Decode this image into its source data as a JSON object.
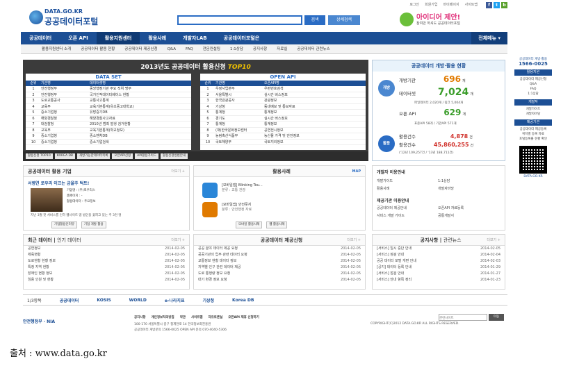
{
  "toplinks": [
    "로그인",
    "회원가입",
    "마이페이지",
    "사이트맵"
  ],
  "social": [
    {
      "label": "f",
      "color": "#3b5998"
    },
    {
      "label": "t",
      "color": "#1da1f2"
    },
    {
      "label": "b",
      "color": "#5aa02c"
    }
  ],
  "logo": {
    "en": "DATA.GO.KR",
    "ko": "공공데이터포털"
  },
  "search": {
    "placeholder": "",
    "button": "검색",
    "advanced": "상세검색"
  },
  "idea": {
    "title": "아이디어 제안!",
    "subtitle": "참여만 하셔도 공공데이터포털"
  },
  "nav": {
    "items": [
      "공공데이터",
      "오픈 API",
      "활용지원센터",
      "활용사례",
      "개발자LAB",
      "공공데이터포털은"
    ],
    "all": "전체메뉴 ▾"
  },
  "subnav": [
    "활용지원센터 소개",
    "공공데이터 활용 현황",
    "공공데이터 제공신청",
    "Q&A",
    "FAQ",
    "전문컨설팅",
    "1:1상담",
    "공지사항",
    "자료실",
    "공공데이터 관련뉴스"
  ],
  "banner": {
    "title_pre": "2013년도 공공데이터 활용신청 ",
    "title_em": "TOP10",
    "dataset": {
      "head": "DATA SET",
      "cols": [
        "순위",
        "기관명",
        "데이터셋명"
      ],
      "rows": [
        [
          "1",
          "안전행정부",
          "중앙행정기관 주요 직위 명부"
        ],
        [
          "2",
          "안전행정부",
          "국가인적데이터베이스 현황"
        ],
        [
          "3",
          "도로교통공사",
          "교통사고통계"
        ],
        [
          "4",
          "교육부",
          "교육기본통계(유초중고대학교)"
        ],
        [
          "5",
          "중소기업청",
          "유망중기DB"
        ],
        [
          "6",
          "해양경찰청",
          "해양경찰사고자료"
        ],
        [
          "7",
          "대검찰청",
          "2010년 범죄 발생 검거현황"
        ],
        [
          "8",
          "교육부",
          "교육기본통계(학교정보)"
        ],
        [
          "9",
          "중소기업청",
          "중소벤처DB"
        ],
        [
          "10",
          "중소기업청",
          "중소기업검색"
        ]
      ]
    },
    "openapi": {
      "head": "OPEN API",
      "cols": [
        "순위",
        "기관명",
        "오픈API명"
      ],
      "rows": [
        [
          "1",
          "우정사업본부",
          "우편번호검색"
        ],
        [
          "2",
          "서울특별시",
          "실시간 버스정보"
        ],
        [
          "3",
          "한국관광공사",
          "관광정보"
        ],
        [
          "4",
          "기상청",
          "동네예보 및 통보자료"
        ],
        [
          "5",
          "통계청",
          "통계정보"
        ],
        [
          "6",
          "경기도",
          "실시간 버스정보"
        ],
        [
          "7",
          "통계청",
          "통계정보"
        ],
        [
          "8",
          "(재)한국문화정보센터",
          "공연전시정보"
        ],
        [
          "9",
          "농림축산식품부",
          "농산물 가격 및 안전정보"
        ],
        [
          "10",
          "국토해양부",
          "국토지리정보"
        ]
      ]
    },
    "bar": [
      "활용신청 TOP10",
      "KOREA DB",
      "개방가능한데이터목록",
      "오픈API신청",
      "API활용가이드",
      "활용신청방법안내"
    ]
  },
  "stats": {
    "title": "공공데이터 개방·활용 현황",
    "open_badge": "개방",
    "use_badge": "활용",
    "rows": [
      {
        "label": "개방기관",
        "value": "696",
        "unit": "개"
      },
      {
        "label": "데이터셋",
        "value": "7,024",
        "unit": "개"
      },
      {
        "label": "오픈 API",
        "value": "629",
        "unit": "개"
      }
    ],
    "note1": "파일데이터 2,020개 / 링크 5,004개",
    "note2": "표준API 58개 / 기관API 571개",
    "use_rows": [
      {
        "label": "활용건수",
        "value": "4,878",
        "unit": "건"
      },
      {
        "label": "활용건수",
        "value": "45,860,255",
        "unit": "건"
      }
    ],
    "note3": "('12년 109,257건 / '13년 188,711건)"
  },
  "company": {
    "title": "공공데이터 활용 기업",
    "more": "더보기 +",
    "headline": "서병연 로우리 이끄는 금을주 턱트!",
    "lines": [
      "기업명 : (주)로우리스",
      "홈페이지 : -",
      "활용데이터 : 주요정보"
    ],
    "desc": "지난 3월 첫 서비스를 인하 웹사이트 앱 법인을 꽃피고 있는 주 3천 명 ",
    "buttons": [
      "기업활용인터뷰",
      "기업 개발 활용"
    ]
  },
  "cases": {
    "title": "활용사례",
    "badge": "MAP",
    "items": [
      {
        "title": "[모바일앱] Blinking Tou...",
        "sub": "분류 : 교통 관광"
      },
      {
        "title": "[모바일앱] 안전뭇지",
        "sub": "분류 : 안전행정 자료"
      }
    ],
    "buttons": [
      "모바일 활용사례",
      "웹 활용사례"
    ]
  },
  "devinfo": {
    "title": "개발자 이용안내",
    "items": [
      "개발가이드",
      "1:1상담",
      "활용사례",
      "개발자마당"
    ],
    "title2": "제공기관 이용안내",
    "items2": [
      "공공데이터 제공안내",
      "오픈API 자료등록",
      "서비스 개발 가이드",
      "공통개발서"
    ]
  },
  "latest": {
    "title": "최근 데이터",
    "tab2": "인기 데이터",
    "more": "더보기 +",
    "rows": [
      {
        "t": "공연정보",
        "d": "2014-02-05"
      },
      {
        "t": "체육현황",
        "d": "2014-02-05"
      },
      {
        "t": "도로현황 현황 정보",
        "d": "2014-02-05"
      },
      {
        "t": "특정 지역 현황",
        "d": "2014-02-05"
      },
      {
        "t": "장애인 현황 정보",
        "d": "2014-02-05"
      },
      {
        "t": "임용 인원 및 현황",
        "d": "2014-02-05"
      }
    ]
  },
  "requests": {
    "title": "공공데이터 제공신청",
    "more": "더보기 +",
    "rows": [
      {
        "t": "공공 분야 데이터 제공 요청",
        "d": "2014-02-05"
      },
      {
        "t": "공공기관의 업무 관련 데이터 요청",
        "d": "2014-02-05"
      },
      {
        "t": "교통정보 현황 데이터 정보",
        "d": "2014-02-05"
      },
      {
        "t": "지역별 인구 관련 데이터 제공",
        "d": "2014-02-05"
      },
      {
        "t": "도로 통행량 정보 요청",
        "d": "2014-02-05"
      },
      {
        "t": "대기 환경 정보 요청",
        "d": "2014-02-05"
      }
    ]
  },
  "notices": {
    "title": "공지사항",
    "tab2": "관련뉴스",
    "more": "더보기 +",
    "rows": [
      {
        "t": "[서비스] 일시 중단 안내",
        "d": "2014-02-05"
      },
      {
        "t": "[서비스] 점검 안내",
        "d": "2014-02-04"
      },
      {
        "t": "공공 데이터 포털 개편 안내",
        "d": "2014-02-03"
      },
      {
        "t": "[공지] 데이터 등록 안내",
        "d": "2014-01-29"
      },
      {
        "t": "[서비스] 점검 안내",
        "d": "2014-01-27"
      },
      {
        "t": "[서비스] 안내 항목 정리",
        "d": "2014-01-23"
      }
    ]
  },
  "side": {
    "phone_label": "공공데이터 개방·활용",
    "phone": "1566-0025",
    "sec1": "활용지원",
    "links1": [
      "공공데이터 제공신청",
      "Q&A",
      "FAQ",
      "1:1상담"
    ],
    "sec2": "개발자",
    "links2": [
      "개발가이드",
      "개발자마당"
    ],
    "sec3": "제공기관",
    "links3": [
      "공공데이터 제공등록",
      "위치별 등록 자료",
      "포털등록률 현황 확인"
    ],
    "qr_label": "DATA.GO.KR"
  },
  "partners": {
    "page": "1/3항목",
    "items": [
      "공공데이터",
      "KOSIS",
      "WORLD",
      "e-나라지표",
      "기상청",
      "Korea DB"
    ]
  },
  "footer": {
    "org1": "안전행정부",
    "org2": "NIA",
    "links": [
      "공지사항",
      "개인정보처리방침",
      "약관",
      "사이트맵",
      "자유토론실",
      "오픈API 제휴 신청하기"
    ],
    "search_placeholder": "관련사이트",
    "go": "이동",
    "addr": "100-170 서울특별시 중구 청계천로 14 한국정보화진흥원",
    "tel": "공공데이터 개방문의 1566-0025  OPEN API 문의 070-4040-5306",
    "copy": "COPYRIGHT(C)2012 DATA.GO.KR ALL RIGHTS RESERVED."
  },
  "caption": "출처 : www.data.go.kr"
}
